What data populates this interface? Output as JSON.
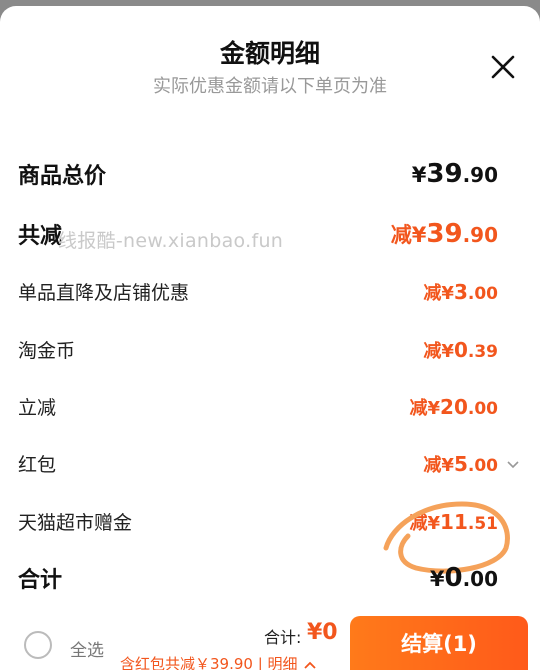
{
  "header": {
    "title": "金额明细",
    "subtitle": "实际优惠金额请以下单页为准"
  },
  "watermark": "线报酷-new.xianbao.fun",
  "rows": {
    "total": {
      "label": "商品总价",
      "currency": "¥",
      "int": "39",
      "dec": ".90"
    },
    "discount": {
      "label": "共减",
      "prefix": "减¥",
      "int": "39",
      "dec": ".90"
    },
    "item_store": {
      "label": "单品直降及店铺优惠",
      "prefix": "减¥",
      "int": "3",
      "dec": ".00"
    },
    "tao_coin": {
      "label": "淘金币",
      "prefix": "减¥",
      "int": "0",
      "dec": ".39"
    },
    "instant": {
      "label": "立减",
      "prefix": "减¥",
      "int": "20",
      "dec": ".00"
    },
    "red_packet": {
      "label": "红包",
      "prefix": "减¥",
      "int": "5",
      "dec": ".00"
    },
    "tmall_gift": {
      "label": "天猫超市赠金",
      "prefix": "减¥",
      "int": "11",
      "dec": ".51"
    },
    "sum": {
      "label": "合计",
      "currency": "¥",
      "int": "0",
      "dec": ".00"
    }
  },
  "footer": {
    "select_all": "全选",
    "total_label": "合计:",
    "total_value": "¥0",
    "red_packet_note": "含红包共减￥39.90 | 明细",
    "checkout": "结算(1)"
  },
  "colors": {
    "accent": "#f2561d",
    "checkout_start": "#ff7a1a",
    "checkout_end": "#ff5a1a",
    "annotation": "#f5a25a"
  },
  "icons": [
    "close-icon",
    "chevron-down-icon",
    "chevron-up-icon",
    "radio-unchecked-icon"
  ]
}
